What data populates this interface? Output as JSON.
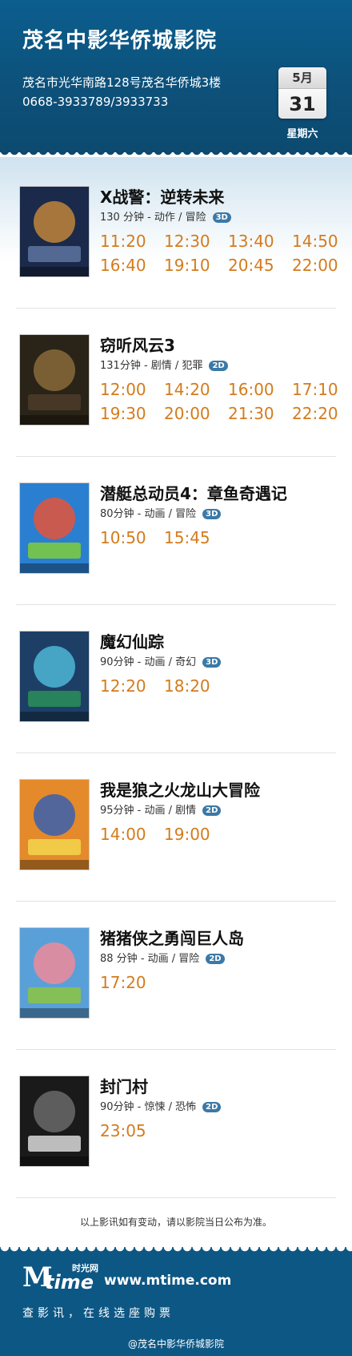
{
  "header": {
    "cinema_name": "茂名中影华侨城影院",
    "address": "茂名市光华南路128号茂名华侨城3楼",
    "phone": "0668-3933789/3933733",
    "month": "5月",
    "day": "31",
    "weekday": "星期六"
  },
  "colors": {
    "header_bg": "#0d5079",
    "time_orange": "#d47b1c",
    "badge_blue": "#3b79a6"
  },
  "movies": [
    {
      "title": "X战警：逆转未来",
      "duration": "130 分钟",
      "genre": "动作 / 冒险",
      "format": "3D",
      "times": [
        "11:20",
        "12:30",
        "13:40",
        "14:50",
        "16:40",
        "19:10",
        "20:45",
        "22:00"
      ]
    },
    {
      "title": "窃听风云3",
      "duration": "131分钟",
      "genre": "剧情 / 犯罪",
      "format": "2D",
      "times": [
        "12:00",
        "14:20",
        "16:00",
        "17:10",
        "19:30",
        "20:00",
        "21:30",
        "22:20"
      ]
    },
    {
      "title": "潜艇总动员4：章鱼奇遇记",
      "duration": "80分钟",
      "genre": "动画 / 冒险",
      "format": "3D",
      "times": [
        "10:50",
        "15:45"
      ]
    },
    {
      "title": "魔幻仙踪",
      "duration": "90分钟",
      "genre": "动画 / 奇幻",
      "format": "3D",
      "times": [
        "12:20",
        "18:20"
      ]
    },
    {
      "title": "我是狼之火龙山大冒险",
      "duration": "95分钟",
      "genre": "动画 / 剧情",
      "format": "2D",
      "times": [
        "14:00",
        "19:00"
      ]
    },
    {
      "title": "猪猪侠之勇闯巨人岛",
      "duration": "88 分钟",
      "genre": "动画 / 冒险",
      "format": "2D",
      "times": [
        "17:20"
      ]
    },
    {
      "title": "封门村",
      "duration": "90分钟",
      "genre": "惊悚 / 恐怖",
      "format": "2D",
      "times": [
        "23:05"
      ]
    }
  ],
  "notice": "以上影讯如有变动，请以影院当日公布为准。",
  "footer": {
    "logo_cn": "时光网",
    "logo_m": "M",
    "logo_time": "time",
    "site": "www.mtime.com",
    "slogan": "查影讯，在线选座购票",
    "weibo": "@茂名中影华侨城影院"
  }
}
